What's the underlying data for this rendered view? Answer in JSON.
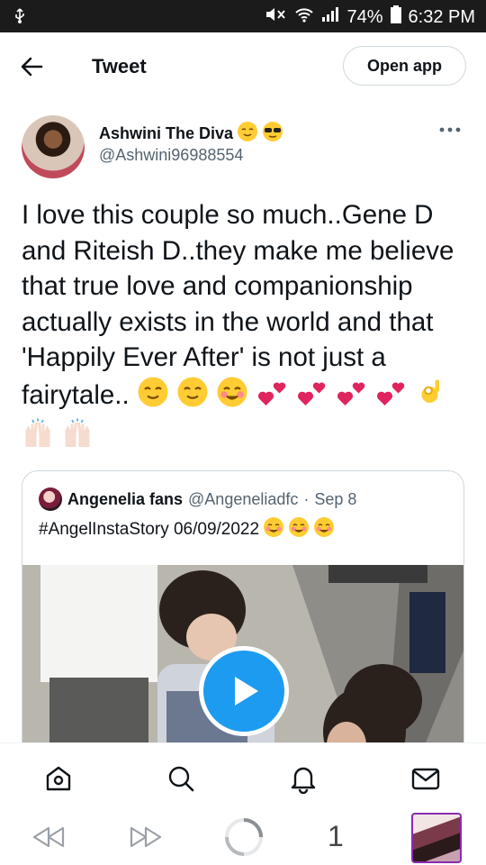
{
  "status_bar": {
    "battery": "74%",
    "time": "6:32 PM"
  },
  "header": {
    "title": "Tweet",
    "open_app": "Open app"
  },
  "author": {
    "name": "Ashwini The Diva",
    "handle": "@Ashwini96988554"
  },
  "tweet": {
    "text": "I love this couple so much..Gene D and Riteish D..they make me believe that true love and companionship actually exists in the world and that 'Happily Ever After' is not just a fairytale.."
  },
  "quote": {
    "name": "Angenelia fans",
    "handle": "@Angeneliadfc",
    "separator": "·",
    "date": "Sep 8",
    "text": "#AngelInstaStory 06/09/2022"
  },
  "browser": {
    "tab_count": "1"
  },
  "icons": {
    "back": "arrow-left-icon",
    "more": "more-horizontal-icon",
    "play": "play-icon",
    "home": "home-icon",
    "search": "search-icon",
    "notifications": "bell-icon",
    "messages": "mail-icon"
  },
  "colors": {
    "accent": "#1d9bf0",
    "text": "#0f1419",
    "muted": "#536471",
    "border": "#cfd9de"
  }
}
